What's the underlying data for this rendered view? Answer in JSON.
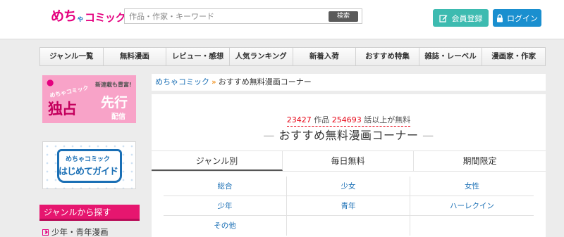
{
  "header": {
    "logo": {
      "part1": "めち",
      "part2": "ゃ",
      "part3": "コミック"
    },
    "search": {
      "placeholder": "作品・作家・キーワード",
      "button": "検索"
    },
    "register_label": "会員登録",
    "login_label": "ログイン",
    "colors": {
      "brand_pink": "#e4007f",
      "register_teal": "#3dbbb0",
      "login_blue": "#1a8fcf"
    }
  },
  "nav": {
    "items": [
      "ジャンル一覧",
      "無料漫画",
      "レビュー・感想",
      "人気ランキング",
      "新着入荷",
      "おすすめ特集",
      "雑誌・レーベル",
      "漫画家・作家"
    ]
  },
  "sidebar": {
    "banner1": {
      "small": "めちゃコミック",
      "big": "独占",
      "new": "新連載も豊富!",
      "senko": "先行",
      "haishin": "配信"
    },
    "banner2": {
      "t1": "めちゃコミック",
      "t2": "はじめてガイド"
    },
    "genre_heading": "ジャンルから探す",
    "genre_item": "少年・青年漫画"
  },
  "main": {
    "breadcrumb": {
      "home": "めちゃコミック",
      "sep": "»",
      "current": "おすすめ無料漫画コーナー"
    },
    "counts": {
      "works": "23427",
      "works_unit": "作品",
      "episodes": "254693",
      "episodes_unit": "話以上が無料"
    },
    "title": "おすすめ無料漫画コーナー",
    "title_dash": "—",
    "tabs": [
      "ジャンル別",
      "毎日無料",
      "期間限定"
    ],
    "active_tab": "ジャンル別",
    "genre_grid": [
      [
        "総合",
        "少女",
        "女性"
      ],
      [
        "少年",
        "青年",
        "ハーレクイン"
      ],
      [
        "その他",
        "",
        ""
      ]
    ]
  }
}
